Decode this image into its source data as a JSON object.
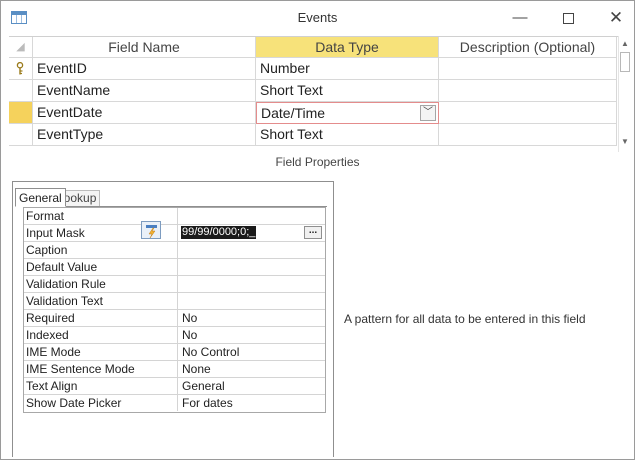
{
  "window": {
    "title": "Events"
  },
  "grid": {
    "headers": {
      "field_name": "Field Name",
      "data_type": "Data Type",
      "description": "Description (Optional)"
    },
    "rows": [
      {
        "name": "EventID",
        "type": "Number",
        "desc": "",
        "primary_key": true
      },
      {
        "name": "EventName",
        "type": "Short Text",
        "desc": ""
      },
      {
        "name": "EventDate",
        "type": "Date/Time",
        "desc": "",
        "selected": true
      },
      {
        "name": "EventType",
        "type": "Short Text",
        "desc": ""
      }
    ]
  },
  "field_properties": {
    "title": "Field Properties",
    "tabs": [
      "General",
      "Lookup"
    ],
    "active_tab": "General",
    "rows": [
      {
        "name": "Format",
        "value": ""
      },
      {
        "name": "Input Mask",
        "value": "99/99/0000;0;_"
      },
      {
        "name": "Caption",
        "value": ""
      },
      {
        "name": "Default Value",
        "value": ""
      },
      {
        "name": "Validation Rule",
        "value": ""
      },
      {
        "name": "Validation Text",
        "value": ""
      },
      {
        "name": "Required",
        "value": "No"
      },
      {
        "name": "Indexed",
        "value": "No"
      },
      {
        "name": "IME Mode",
        "value": "No Control"
      },
      {
        "name": "IME Sentence Mode",
        "value": "None"
      },
      {
        "name": "Text Align",
        "value": "General"
      },
      {
        "name": "Show Date Picker",
        "value": "For dates"
      }
    ],
    "build_button": "...",
    "help_text": "A pattern for all data to be entered in this field"
  },
  "colors": {
    "selected_header": "#f7e27a",
    "row_selector_active": "#f5d25c",
    "active_cell_border": "#e48c8c"
  },
  "icons": [
    "table-icon",
    "minimize-icon",
    "maximize-icon",
    "close-icon",
    "primary-key-icon",
    "dropdown-arrow-icon",
    "input-mask-wizard-icon"
  ]
}
